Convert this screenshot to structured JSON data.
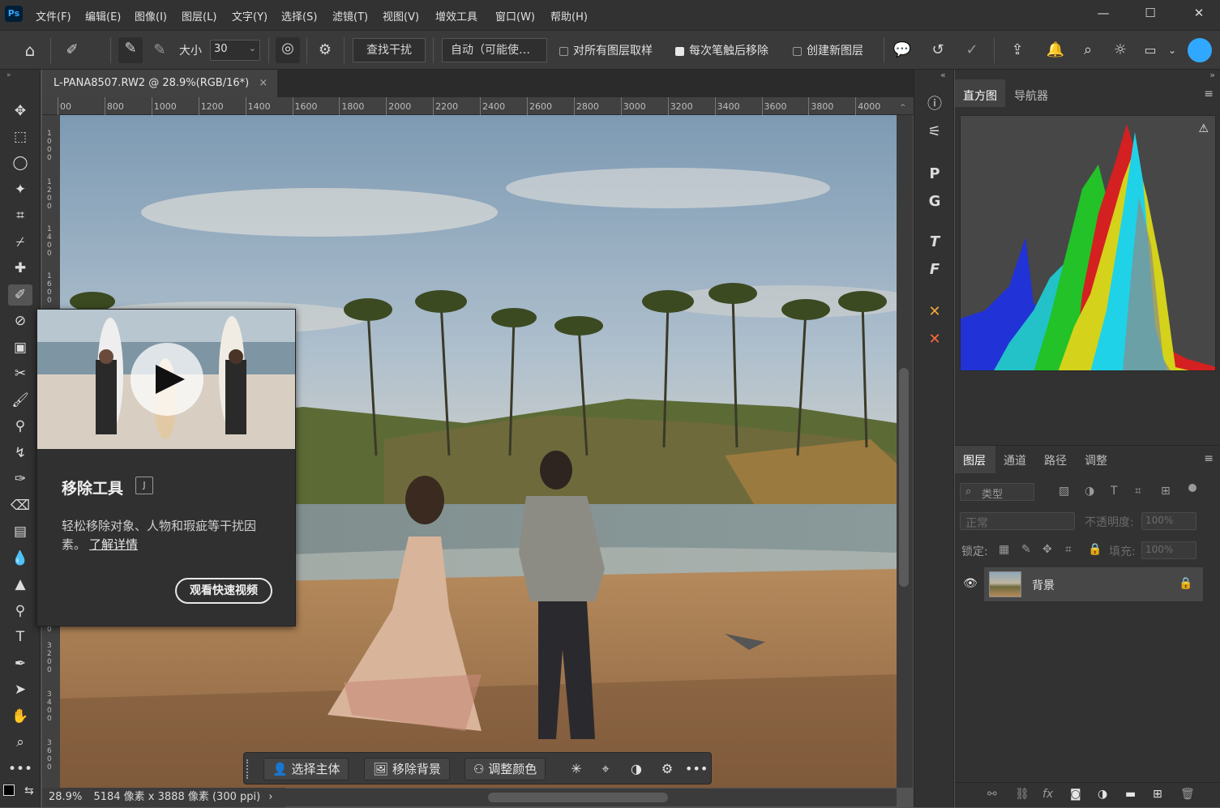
{
  "app": {
    "logo": "Ps"
  },
  "menubar": {
    "items": [
      "文件(F)",
      "编辑(E)",
      "图像(I)",
      "图层(L)",
      "文字(Y)",
      "选择(S)",
      "滤镜(T)",
      "视图(V)",
      "增效工具",
      "窗口(W)",
      "帮助(H)"
    ]
  },
  "window_controls": {
    "minimize": "—",
    "maximize": "☐",
    "close": "✕"
  },
  "options": {
    "size_label": "大小",
    "size_value": "30",
    "find_distractions": "查找干扰",
    "mode_value": "自动（可能使…",
    "sample_all_layers": "对所有图层取样",
    "sample_all_checked": false,
    "remove_after_stroke": "每次笔触后移除",
    "remove_after_checked": true,
    "create_new_layer": "创建新图层",
    "create_new_checked": false
  },
  "document": {
    "tab_title": "L-PANA8507.RW2 @ 28.9%(RGB/16*)",
    "close": "×"
  },
  "ruler": {
    "h_ticks": [
      "00",
      "800",
      "1000",
      "1200",
      "1400",
      "1600",
      "1800",
      "2000",
      "2200",
      "2400",
      "2600",
      "2800",
      "3000",
      "3200",
      "3400",
      "3600",
      "3800",
      "4000"
    ],
    "v_ticks": [
      "1000",
      "1200",
      "1400",
      "1600",
      "0",
      "3200",
      "3400",
      "3600"
    ]
  },
  "status": {
    "zoom": "28.9%",
    "dimensions": "5184 像素 x 3888 像素 (300 ppi)",
    "arrow": "›"
  },
  "contextual_taskbar": {
    "select_subject": "选择主体",
    "remove_background": "移除背景",
    "adjust_color": "调整颜色",
    "more": "•••"
  },
  "tooltip_popup": {
    "title": "移除工具",
    "shortcut": "J",
    "description": "轻松移除对象、人物和瑕疵等干扰因素。",
    "learn_more": "了解详情",
    "watch_video": "观看快速视频"
  },
  "histogram_panel": {
    "tabs": [
      "直方图",
      "导航器"
    ],
    "warning": "⚠"
  },
  "layers_panel": {
    "tabs": [
      "图层",
      "通道",
      "路径",
      "调整"
    ],
    "filter_label": "类型",
    "blend_mode": "正常",
    "opacity_label": "不透明度:",
    "opacity_value": "100%",
    "lock_label": "锁定:",
    "fill_label": "填充:",
    "fill_value": "100%",
    "layers": [
      {
        "name": "背景",
        "visible": true,
        "locked": true
      }
    ]
  },
  "colors": {
    "accent": "#31a8ff",
    "panel": "#323232",
    "canvas_bg": "#535353"
  }
}
